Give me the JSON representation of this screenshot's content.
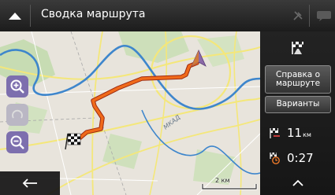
{
  "header": {
    "title": "Сводка маршрута",
    "left_icon": "chevron-up-icon",
    "right_icons": [
      "tools-icon",
      "chat-bubble-icon"
    ]
  },
  "map": {
    "road_label": "МКАД",
    "scale_label": "2 км",
    "zoom_in_icon": "zoom-in-icon",
    "zoom_out_icon": "zoom-out-icon",
    "rotate_icon": "rotate-icon",
    "destination_icon": "checkered-flag-icon",
    "position_icon": "navigation-arrow-icon"
  },
  "panel": {
    "top_icon": "flag-on-road-icon",
    "route_info_label": "Справка о маршруте",
    "variants_label": "Варианты",
    "distance": {
      "value": "11",
      "unit": "км",
      "icon": "route-distance-icon"
    },
    "time": {
      "value": "0:27",
      "icon": "route-time-icon"
    },
    "expand_icon": "chevron-up-icon"
  },
  "footer": {
    "back_icon": "back-arrow-icon"
  },
  "colors": {
    "route": "#f06a1a",
    "route_outline": "#9c2a10",
    "river": "#3e86cc",
    "map_bg": "#e8e4dc",
    "park": "#c2d9ad",
    "zoom_button": "#8070aa"
  }
}
